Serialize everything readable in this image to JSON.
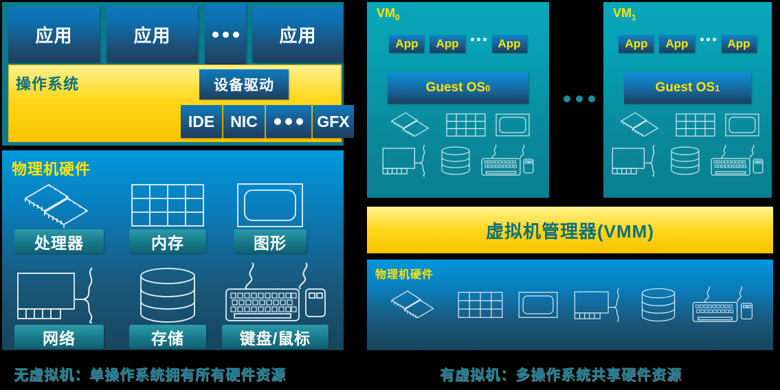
{
  "left_panel": {
    "apps": [
      {
        "label": "应用"
      },
      {
        "label": "应用"
      },
      {
        "label": "应用"
      }
    ],
    "app_ellipsis": "•••",
    "os": {
      "label": "操作系统",
      "driver_label": "设备驱动",
      "controllers": [
        "IDE",
        "NIC",
        "•••",
        "GFX"
      ]
    },
    "hardware": {
      "title": "物理机硬件",
      "items": [
        {
          "icon": "cpu-icon",
          "label": "处理器"
        },
        {
          "icon": "memory-icon",
          "label": "内存"
        },
        {
          "icon": "graphics-icon",
          "label": "图形"
        },
        {
          "icon": "network-card-icon",
          "label": "网络"
        },
        {
          "icon": "storage-icon",
          "label": "存储"
        },
        {
          "icon": "keyboard-mouse-icon",
          "label": "键盘/鼠标"
        }
      ]
    },
    "caption": "无虚拟机：单操作系统拥有所有硬件资源"
  },
  "right_panel": {
    "vms": [
      {
        "title": "VM",
        "index": "0",
        "apps": [
          "App",
          "App",
          "App"
        ],
        "app_ellipsis": "•••",
        "guest_os": "Guest OS",
        "guest_os_index": "0"
      },
      {
        "title": "VM",
        "index": "1",
        "apps": [
          "App",
          "App",
          "App"
        ],
        "app_ellipsis": "•••",
        "guest_os": "Guest OS",
        "guest_os_index": "1"
      }
    ],
    "vm_separator": "•••",
    "vmm_label": "虚拟机管理器(VMM)",
    "hardware": {
      "title": "物理机硬件",
      "icons": [
        "cpu-icon",
        "memory-icon",
        "graphics-icon",
        "network-card-icon",
        "storage-icon",
        "keyboard-mouse-icon"
      ]
    },
    "caption": "有虚拟机：多操作系统共享硬件资源"
  },
  "colors": {
    "teal_frame": "#0a7b8c",
    "yellow_os": "#ffd616",
    "blue_hw_top": "#0098dd",
    "blue_hw_bottom": "#17455e",
    "vm_teal": "#0a8a9c",
    "caption_text": "#1d7e92",
    "accent_yellow_text": "#ffe500",
    "app_blue": "#0d7bbe"
  }
}
